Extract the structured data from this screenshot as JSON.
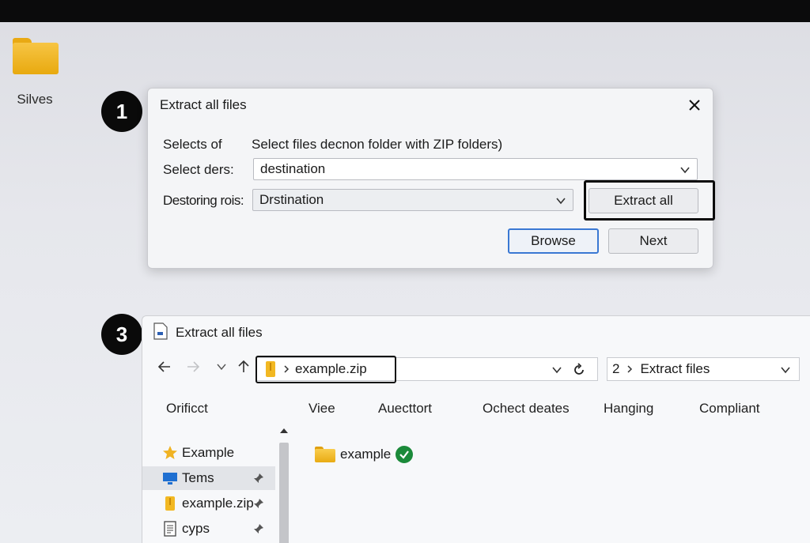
{
  "desktop": {
    "icon_label": "Silves"
  },
  "badges": {
    "first": "1",
    "second": "3"
  },
  "dialog": {
    "title": "Extract all files",
    "row1_label": "Selects of",
    "row1_text": "Select files decnon folder with ZIP folders)",
    "row2_label": "Select ders:",
    "row2_value": "destination",
    "row3_label": "Destoring rois:",
    "row3_value": "Drstination",
    "extract_button": "Extract all",
    "browse_button": "Browse",
    "next_button": "Next"
  },
  "explorer": {
    "title": "Extract all files",
    "address_path": "example.zip",
    "path2_prefix": "2",
    "path2_label": "Extract files",
    "columns": [
      "Orificct",
      "Viee",
      "Auecttort",
      "Ochect deates",
      "Hanging",
      "Compliant"
    ],
    "sidebar": [
      {
        "label": "Example",
        "icon": "star-icon"
      },
      {
        "label": "Tems",
        "icon": "monitor-icon"
      },
      {
        "label": "example.zip",
        "icon": "zip-folder-icon"
      },
      {
        "label": "cyps",
        "icon": "document-icon"
      }
    ],
    "content_folder": "example"
  },
  "colors": {
    "accent": "#3a78d3",
    "folder": "#f2b822",
    "success": "#1b8a3a",
    "highlight": "#0a0a0a"
  }
}
